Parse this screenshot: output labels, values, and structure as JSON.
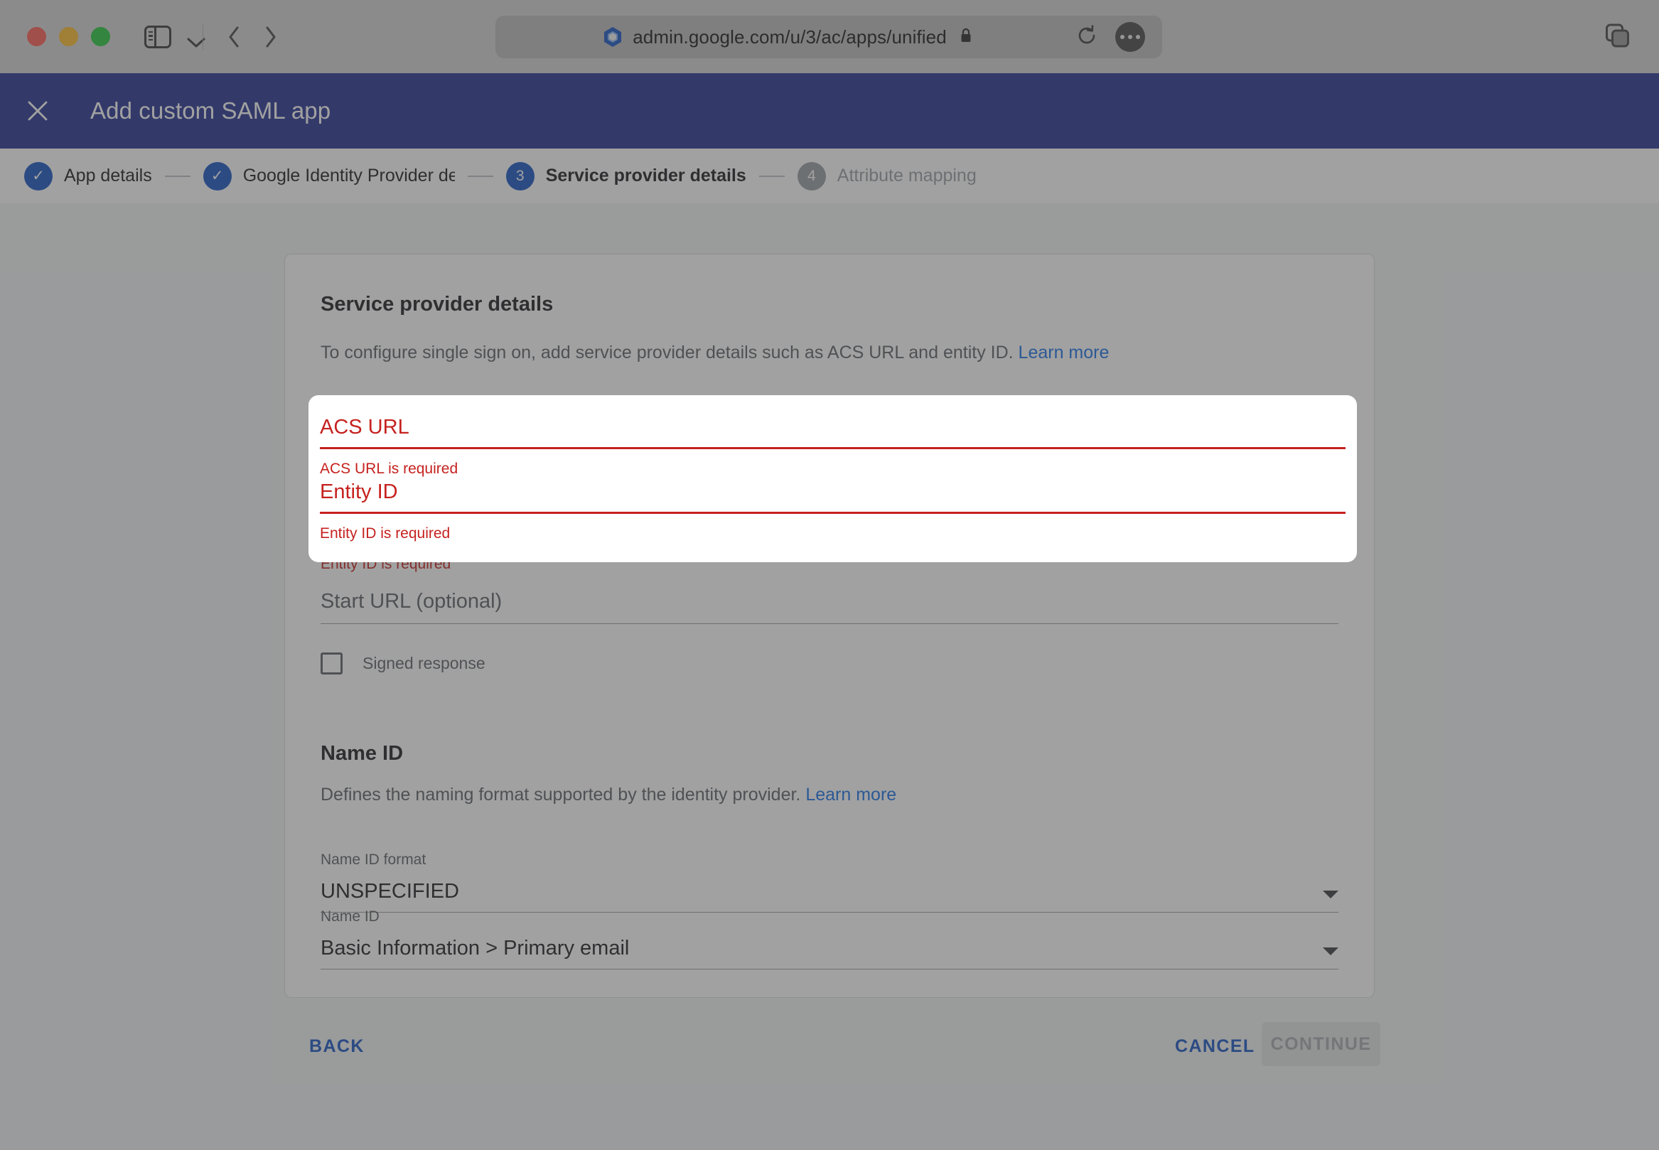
{
  "browser": {
    "window_controls": [
      "close",
      "minimize",
      "maximize"
    ],
    "sidebar_toggle_icon": "sidebar-icon",
    "chevron_icon": "chevron-down-icon",
    "back_icon": "chevron-left-icon",
    "forward_icon": "chevron-right-icon",
    "favicon": "google-admin-hexagon-icon",
    "url": "admin.google.com/u/3/ac/apps/unified",
    "lock_icon": "lock-icon",
    "reload_icon": "reload-icon",
    "more_icon": "more-dots-icon",
    "tabs_overview_icon": "tabs-overview-icon"
  },
  "app_header": {
    "close_icon": "close-icon",
    "title": "Add custom SAML app",
    "background_color": "#283593"
  },
  "stepper": {
    "steps": [
      {
        "badge": "✓",
        "label": "App details",
        "state": "done"
      },
      {
        "badge": "✓",
        "label": "Google Identity Provider details",
        "state": "done"
      },
      {
        "badge": "3",
        "label": "Service provider details",
        "state": "active"
      },
      {
        "badge": "4",
        "label": "Attribute mapping",
        "state": "todo"
      }
    ],
    "active_color": "#1a56c5",
    "todo_color": "#9aa0a6"
  },
  "card": {
    "title": "Service provider details",
    "description": "To configure single sign on, add service provider details such as ACS URL and entity ID.",
    "description_link": "Learn more",
    "fields": {
      "acs_url": {
        "label": "ACS URL",
        "value": "",
        "error": "ACS URL is required",
        "state": "error"
      },
      "entity_id": {
        "label": "Entity ID",
        "value": "",
        "error": "Entity ID is required",
        "state": "error"
      },
      "start_url": {
        "placeholder": "Start URL (optional)",
        "value": ""
      },
      "signed_response": {
        "label": "Signed response",
        "checked": false
      }
    },
    "name_id_section": {
      "title": "Name ID",
      "description": "Defines the naming format supported by the identity provider.",
      "description_link": "Learn more",
      "name_id_format": {
        "caption": "Name ID format",
        "value": "UNSPECIFIED"
      },
      "name_id": {
        "caption": "Name ID",
        "value": "Basic Information > Primary email"
      },
      "dropdown_icon": "chevron-down-icon"
    },
    "error_color": "#c5221f",
    "link_color": "#1a73e8"
  },
  "footer": {
    "back_label": "BACK",
    "cancel_label": "CANCEL",
    "continue_label": "CONTINUE",
    "continue_disabled": true
  }
}
